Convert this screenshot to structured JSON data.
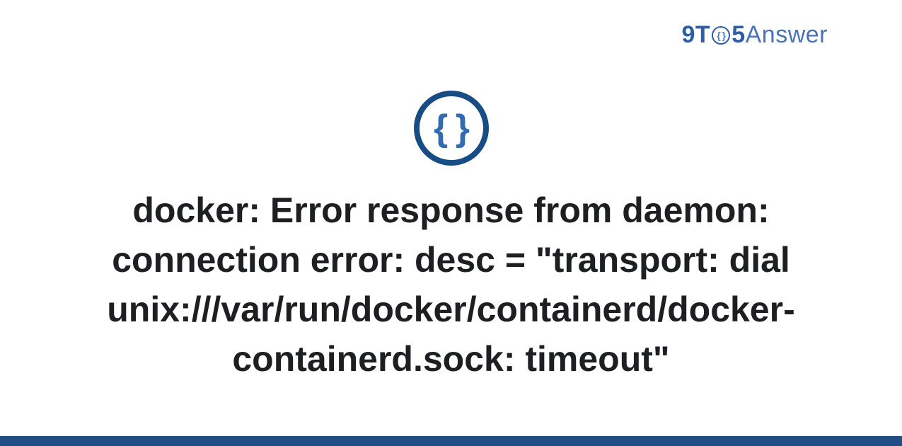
{
  "header": {
    "logo_prefix": "9T",
    "logo_middle": "5",
    "logo_suffix": "Answer",
    "logo_small_braces": "{ }"
  },
  "main": {
    "icon_braces": "{ }",
    "title": "docker: Error response from daemon: connection error: desc = \"transport: dial unix:///var/run/docker/containerd/docker-containerd.sock: timeout\""
  }
}
